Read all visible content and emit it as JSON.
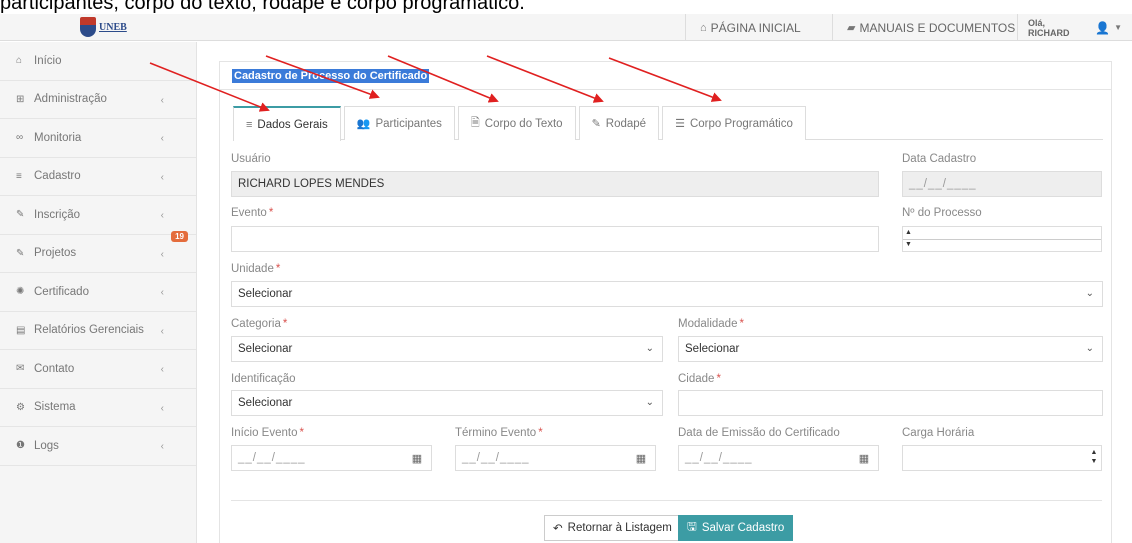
{
  "caption": "participantes, corpo do texto, rodapé e corpo programático.",
  "header": {
    "logo_text": "UNEB",
    "home_label": "PÁGINA INICIAL",
    "manuals_label": "MANUAIS E DOCUMENTOS",
    "greeting": "Olá, RICHARD"
  },
  "sidebar": {
    "items": [
      {
        "label": "Início",
        "icon": "home-icon",
        "glyph": "⌂"
      },
      {
        "label": "Administração",
        "icon": "sitemap-icon",
        "glyph": "⊞"
      },
      {
        "label": "Monitoria",
        "icon": "binoculars-icon",
        "glyph": "∞"
      },
      {
        "label": "Cadastro",
        "icon": "list-icon",
        "glyph": "≡"
      },
      {
        "label": "Inscrição",
        "icon": "edit-icon",
        "glyph": "✎"
      },
      {
        "label": "Projetos",
        "icon": "edit-icon",
        "glyph": "✎",
        "badge": "19"
      },
      {
        "label": "Certificado",
        "icon": "certificate-icon",
        "glyph": "✺"
      },
      {
        "label": "Relatórios Gerenciais",
        "icon": "report-icon",
        "glyph": "▤"
      },
      {
        "label": "Contato",
        "icon": "envelope-icon",
        "glyph": "✉"
      },
      {
        "label": "Sistema",
        "icon": "cogs-icon",
        "glyph": "⚙"
      },
      {
        "label": "Logs",
        "icon": "info-icon",
        "glyph": "❶"
      }
    ]
  },
  "panel": {
    "title": "Cadastro de Processo do Certificado",
    "tabs": [
      {
        "label": "Dados Gerais",
        "glyph": "≡"
      },
      {
        "label": "Participantes",
        "glyph": "👥"
      },
      {
        "label": "Corpo do Texto",
        "glyph": "🗎"
      },
      {
        "label": "Rodapé",
        "glyph": "✎"
      },
      {
        "label": "Corpo Programático",
        "glyph": "☰"
      }
    ]
  },
  "form": {
    "usuario_label": "Usuário",
    "usuario_value": "RICHARD LOPES MENDES",
    "data_cadastro_label": "Data Cadastro",
    "data_cadastro_value": "__/__/____",
    "evento_label": "Evento",
    "processo_label": "Nº do Processo",
    "unidade_label": "Unidade",
    "unidade_value": "Selecionar",
    "categoria_label": "Categoria",
    "categoria_value": "Selecionar",
    "modalidade_label": "Modalidade",
    "modalidade_value": "Selecionar",
    "identificacao_label": "Identificação",
    "identificacao_value": "Selecionar",
    "cidade_label": "Cidade",
    "inicio_label": "Início Evento",
    "inicio_value": "__/__/____",
    "termino_label": "Término Evento",
    "termino_value": "__/__/____",
    "emissao_label": "Data de Emissão do Certificado",
    "emissao_value": "__/__/____",
    "carga_label": "Carga Horária",
    "required_mark": "*"
  },
  "buttons": {
    "back_label": "Retornar à Listagem",
    "save_label": "Salvar Cadastro"
  },
  "colors": {
    "accent": "#3c9ca4",
    "badge": "#e46c3c",
    "arrow": "#e02020",
    "title_highlight": "#3b7bd9"
  }
}
